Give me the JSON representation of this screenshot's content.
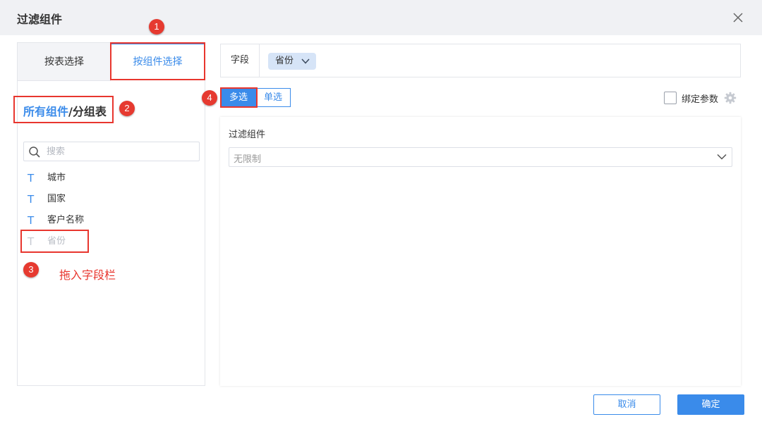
{
  "dialog": {
    "title": "过滤组件"
  },
  "left": {
    "tabs": [
      {
        "label": "按表选择"
      },
      {
        "label": "按组件选择"
      }
    ],
    "breadcrumb": {
      "link": "所有组件",
      "separator": "/",
      "current": "分组表"
    },
    "search": {
      "placeholder": "搜索",
      "value": ""
    },
    "fields": [
      {
        "icon": "T",
        "label": "城市"
      },
      {
        "icon": "T",
        "label": "国家"
      },
      {
        "icon": "T",
        "label": "客户名称"
      },
      {
        "icon": "T",
        "label": "省份"
      }
    ]
  },
  "right": {
    "field_bar": {
      "label": "字段",
      "chip": "省份"
    },
    "mode": {
      "multi": "多选",
      "single": "单选"
    },
    "bind_param": "绑定参数",
    "preview": {
      "label": "过滤组件",
      "select_value": "无限制"
    }
  },
  "footer": {
    "cancel": "取消",
    "ok": "确定"
  },
  "annotations": {
    "badges": [
      "1",
      "2",
      "3",
      "4"
    ],
    "drag_note": "拖入字段栏"
  },
  "colors": {
    "accent": "#3a8bea",
    "annotation_red": "#e8362e",
    "title_bar": "#f0f1f4"
  }
}
